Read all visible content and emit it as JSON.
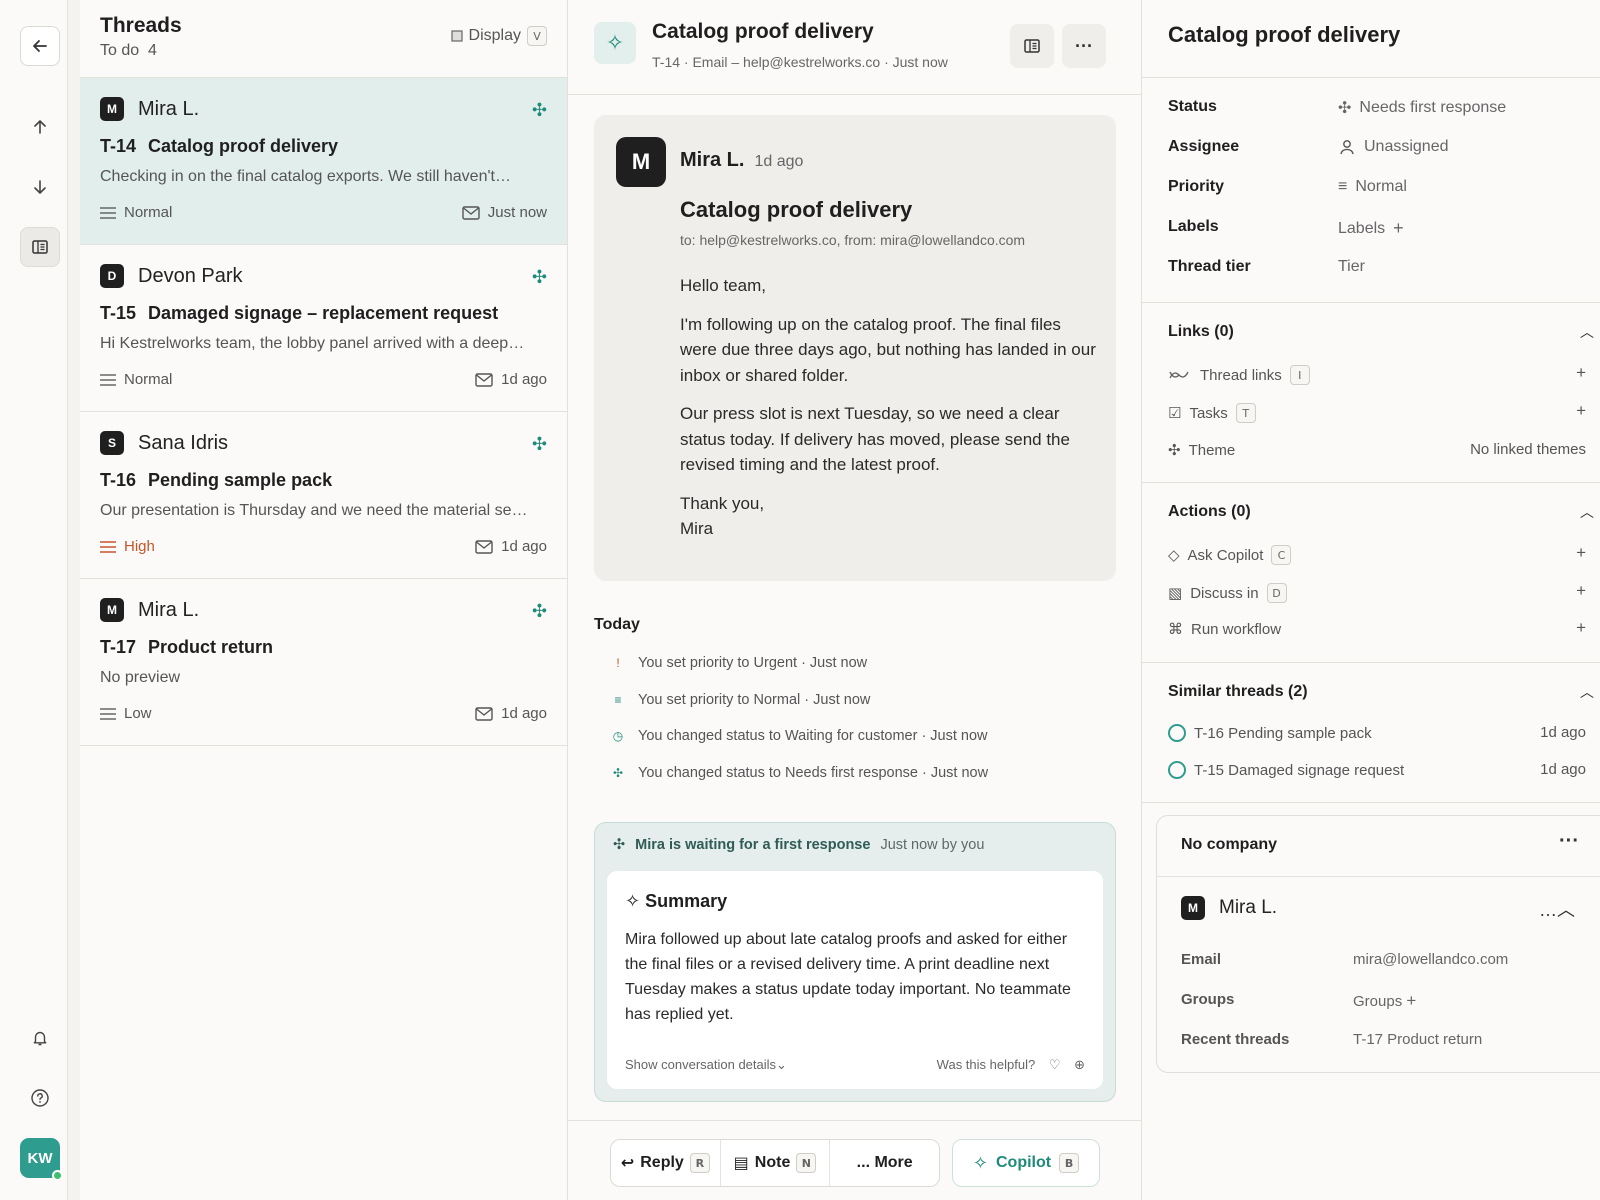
{
  "rail": {
    "icons": [
      "back-arrow-icon",
      "arrow-up-icon",
      "arrow-down-icon",
      "panel-icon",
      "bell-icon",
      "help-icon"
    ],
    "avatar_initials": "KW"
  },
  "list": {
    "title": "Threads",
    "subtitle": "To do  4",
    "display_label": "Display",
    "display_key": "V",
    "threads": [
      {
        "badge": "M",
        "author": "Mira L.",
        "id": "T-14",
        "subject": "Catalog proof delivery",
        "preview": "Checking in on the final catalog exports. We still haven't…",
        "priority": "Normal",
        "time": "Just now",
        "selected": true
      },
      {
        "badge": "D",
        "author": "Devon Park",
        "id": "T-15",
        "subject": "Damaged signage – replacement request",
        "preview": "Hi Kestrelworks team, the lobby panel arrived with a deep…",
        "priority": "Normal",
        "time": "1d ago"
      },
      {
        "badge": "S",
        "author": "Sana Idris",
        "id": "T-16",
        "subject": "Pending sample pack",
        "preview": "Our presentation is Thursday and we need the material se…",
        "priority": "High",
        "time": "1d ago"
      },
      {
        "badge": "M",
        "author": "Mira L.",
        "id": "T-17",
        "subject": "Product return",
        "preview": "No preview",
        "priority": "Low",
        "time": "1d ago"
      }
    ]
  },
  "thread": {
    "title": "Catalog proof delivery",
    "meta": "T-14 · Email – help@kestrelworks.co · Just now",
    "message": {
      "badge": "M",
      "author": "Mira L.",
      "ago": "1d ago",
      "subject": "Catalog proof delivery",
      "to_line": "to: help@kestrelworks.co, from: mira@lowellandco.com",
      "p1": "Hello team,",
      "p2": "I'm following up on the catalog proof. The final files were due three days ago, but nothing has landed in our inbox or shared folder.",
      "p3": "Our press slot is next Tuesday, so we need a clear status today. If delivery has moved, please send the revised timing and the latest proof.",
      "p4a": "Thank you,",
      "p4b": "Mira"
    },
    "today_label": "Today",
    "activity": [
      {
        "icon": "!",
        "text": "You set priority to Urgent · Just now"
      },
      {
        "icon": "≡",
        "text": "You set priority to Normal · Just now"
      },
      {
        "icon": "◷",
        "text": "You changed status to Waiting for customer · Just now"
      },
      {
        "icon": "✣",
        "text": "You changed status to Needs first response · Just now"
      }
    ],
    "waiting": {
      "headline": "Mira is waiting for a first response",
      "when": "Just now by you",
      "summary_title": "Summary",
      "summary_text": "Mira followed up about late catalog proofs and asked for either the final files or a revised delivery time. A print deadline next Tuesday makes a status update today important. No teammate has replied yet.",
      "details_link": "Show conversation details",
      "helpful": "Was this helpful?"
    },
    "footer": {
      "reply": "Reply",
      "reply_key": "R",
      "note": "Note",
      "note_key": "N",
      "more": "... More",
      "copilot": "Copilot",
      "copilot_key": "B"
    }
  },
  "details": {
    "title": "Catalog proof delivery",
    "props": {
      "status_k": "Status",
      "status_v": "Needs first response",
      "assignee_k": "Assignee",
      "assignee_v": "Unassigned",
      "priority_k": "Priority",
      "priority_v": "Normal",
      "labels_k": "Labels",
      "labels_v": "Labels",
      "tier_k": "Thread tier",
      "tier_v": "Tier"
    },
    "links": {
      "header": "Links (0)",
      "thread_links": "Thread links",
      "thread_links_key": "I",
      "tasks": "Tasks",
      "tasks_key": "T",
      "theme": "Theme",
      "theme_value": "No linked themes"
    },
    "actions": {
      "header": "Actions (0)",
      "ask": "Ask Copilot",
      "ask_key": "C",
      "discuss": "Discuss in",
      "discuss_key": "D",
      "run": "Run workflow"
    },
    "similar": {
      "header": "Similar threads (2)",
      "items": [
        {
          "label": "T-16 Pending sample pack",
          "time": "1d ago"
        },
        {
          "label": "T-15 Damaged signage request",
          "time": "1d ago"
        }
      ]
    },
    "company": {
      "header": "No company",
      "badge": "M",
      "name": "Mira L.",
      "email_k": "Email",
      "email_v": "mira@lowellandco.com",
      "groups_k": "Groups",
      "groups_v": "Groups",
      "recent_k": "Recent threads",
      "recent_v": "T-17 Product return"
    }
  },
  "colors": {
    "accent": "#1f8a7a",
    "selected_bg": "#e2eeec",
    "high_priority": "#c3562b"
  }
}
